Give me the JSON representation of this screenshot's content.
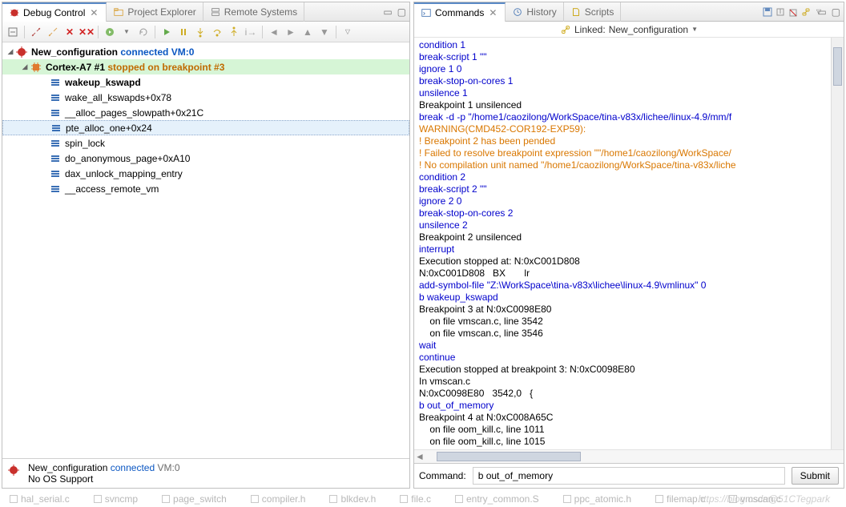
{
  "left": {
    "tabs": {
      "debug": "Debug Control",
      "project": "Project Explorer",
      "remote": "Remote Systems"
    },
    "tree": {
      "conn": "New_configuration",
      "conn_suffix": "connected  VM:0",
      "core": "Cortex-A7 #1",
      "core_suffix": "stopped on breakpoint #3",
      "frames": [
        "wakeup_kswapd",
        "wake_all_kswapds+0x78",
        "__alloc_pages_slowpath+0x21C",
        "pte_alloc_one+0x24",
        "spin_lock",
        "do_anonymous_page+0xA10",
        "dax_unlock_mapping_entry",
        "__access_remote_vm"
      ]
    },
    "status": {
      "name": "New_configuration",
      "state": "connected",
      "vm": "VM:0",
      "os": "No OS Support"
    }
  },
  "right": {
    "tabs": {
      "commands": "Commands",
      "close": "✕",
      "history": "History",
      "scripts": "Scripts"
    },
    "linked_label": "Linked:",
    "linked_target": "New_configuration",
    "console": [
      {
        "c": "blue",
        "t": "condition 1"
      },
      {
        "c": "blue",
        "t": "break-script 1 \"\""
      },
      {
        "c": "blue",
        "t": "ignore 1 0"
      },
      {
        "c": "blue",
        "t": "break-stop-on-cores 1"
      },
      {
        "c": "blue",
        "t": "unsilence 1"
      },
      {
        "c": "black",
        "t": "Breakpoint 1 unsilenced"
      },
      {
        "c": "blue",
        "t": "break -d -p \"/home1/caozilong/WorkSpace/tina-v83x/lichee/linux-4.9/mm/f"
      },
      {
        "c": "orange",
        "t": "WARNING(CMD452-COR192-EXP59):"
      },
      {
        "c": "orange",
        "t": "! Breakpoint 2 has been pended"
      },
      {
        "c": "orange",
        "t": "! Failed to resolve breakpoint expression \"\"/home1/caozilong/WorkSpace/"
      },
      {
        "c": "orange",
        "t": "! No compilation unit named \"/home1/caozilong/WorkSpace/tina-v83x/liche"
      },
      {
        "c": "blue",
        "t": "condition 2"
      },
      {
        "c": "blue",
        "t": "break-script 2 \"\""
      },
      {
        "c": "blue",
        "t": "ignore 2 0"
      },
      {
        "c": "blue",
        "t": "break-stop-on-cores 2"
      },
      {
        "c": "blue",
        "t": "unsilence 2"
      },
      {
        "c": "black",
        "t": "Breakpoint 2 unsilenced"
      },
      {
        "c": "blue",
        "t": "interrupt"
      },
      {
        "c": "black",
        "t": "Execution stopped at: N:0xC001D808"
      },
      {
        "c": "black",
        "t": "N:0xC001D808   BX       lr"
      },
      {
        "c": "blue",
        "t": "add-symbol-file \"Z:\\WorkSpace\\tina-v83x\\lichee\\linux-4.9\\vmlinux\" 0"
      },
      {
        "c": "blue",
        "t": "b wakeup_kswapd"
      },
      {
        "c": "black",
        "t": "Breakpoint 3 at N:0xC0098E80"
      },
      {
        "c": "black",
        "t": "    on file vmscan.c, line 3542"
      },
      {
        "c": "black",
        "t": "    on file vmscan.c, line 3546"
      },
      {
        "c": "blue",
        "t": "wait"
      },
      {
        "c": "blue",
        "t": "continue"
      },
      {
        "c": "black",
        "t": "Execution stopped at breakpoint 3: N:0xC0098E80"
      },
      {
        "c": "black",
        "t": "In vmscan.c"
      },
      {
        "c": "black",
        "t": "N:0xC0098E80   3542,0   {"
      },
      {
        "c": "blue",
        "t": "b out_of_memory"
      },
      {
        "c": "black",
        "t": "Breakpoint 4 at N:0xC008A65C"
      },
      {
        "c": "black",
        "t": "    on file oom_kill.c, line 1011"
      },
      {
        "c": "black",
        "t": "    on file oom_kill.c, line 1015"
      }
    ],
    "cmd_label": "Command:",
    "cmd_value": "b out_of_memory",
    "submit": "Submit",
    "watermark": "https://blog.csdn@51CTegpark"
  },
  "footer": [
    "hal_serial.c",
    "svncmp",
    "page_switch",
    "compiler.h",
    "blkdev.h",
    "file.c",
    "entry_common.S",
    "ppc_atomic.h",
    "filemap.c",
    "vmscan.c"
  ]
}
